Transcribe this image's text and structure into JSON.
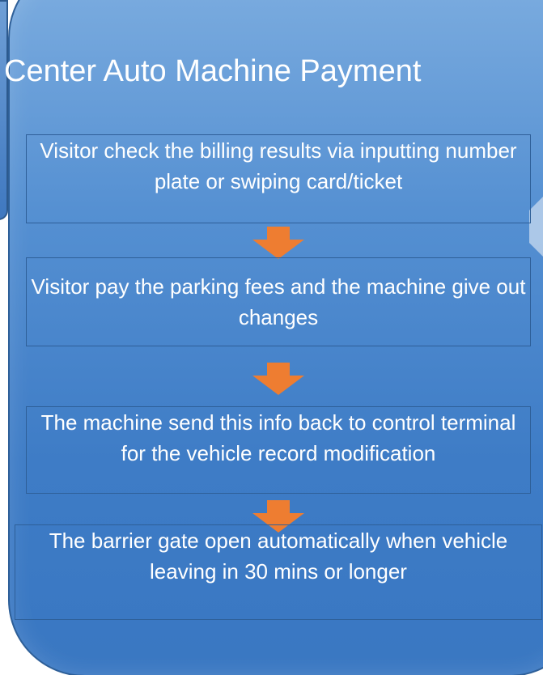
{
  "title": "Center Auto Machine Payment",
  "steps": [
    "Visitor check the billing results via inputting number plate or swiping card/ticket",
    "Visitor pay the parking fees and the machine give out changes",
    "The machine send this info back to control terminal for the vehicle record modification",
    "The barrier gate open automatically when vehicle leaving in 30 mins or longer"
  ],
  "colors": {
    "panel_top": "#7eaee0",
    "panel_bottom": "#3977c2",
    "border": "#2e5f98",
    "arrow": "#ee7d31",
    "text": "#ffffff"
  },
  "icons": {
    "connector": "down-arrow-icon"
  }
}
